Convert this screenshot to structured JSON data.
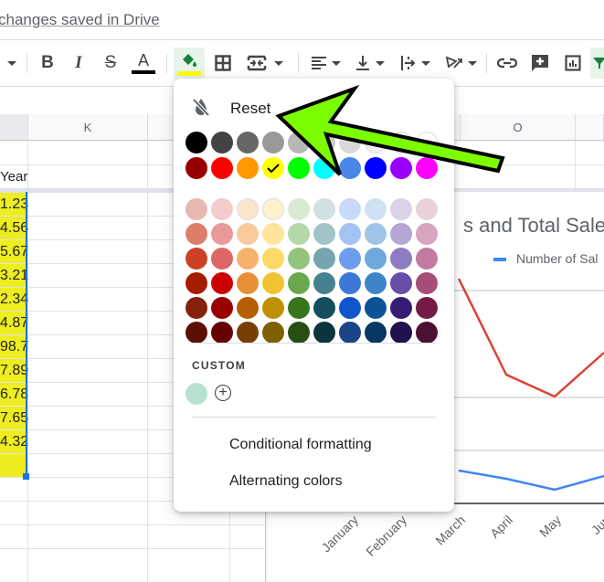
{
  "header": {
    "saved_status": "changes saved in Drive"
  },
  "toolbar": {
    "items": [
      "font-size-dropdown",
      "bold",
      "italic",
      "strikethrough",
      "text-color",
      "fill-color",
      "borders",
      "merge-cells",
      "horizontal-align",
      "vertical-align",
      "text-wrapping",
      "text-rotation",
      "insert-link",
      "insert-comment",
      "insert-chart",
      "filter"
    ],
    "bold_label": "B",
    "italic_label": "I",
    "strike_label": "S",
    "textcolor_label": "A",
    "text_color_bar": "#000000",
    "fill_color_bar": "#ffff00",
    "accent": "#188038"
  },
  "grid": {
    "columns": [
      {
        "label": ""
      },
      {
        "label": "K"
      },
      {
        "label": ""
      },
      {
        "label": ""
      },
      {
        "label": "O"
      },
      {
        "label": ""
      }
    ],
    "header_fragment": "Year",
    "values": [
      "1.23",
      "4.56",
      "5.67",
      "3.21",
      "2.34",
      "4.87",
      "98.7",
      "7.89",
      "6.78",
      "7.65",
      "4.32",
      ""
    ],
    "highlight_color": "#eded1f"
  },
  "fill_menu": {
    "reset_label": "Reset",
    "custom_label": "CUSTOM",
    "custom_colors": [
      "#b7e1cd"
    ],
    "add_custom_label": "+",
    "conditional_formatting_label": "Conditional formatting",
    "alternating_colors_label": "Alternating colors",
    "selected_color": "#ffff00",
    "palette": [
      [
        "#000000",
        "#434343",
        "#666666",
        "#999999",
        "#b7b7b7",
        "#cccccc",
        "#d9d9d9",
        "#efefef",
        "#f3f3f3",
        "#ffffff"
      ],
      [
        "#980000",
        "#ff0000",
        "#ff9900",
        "#ffff00",
        "#00ff00",
        "#00ffff",
        "#4a86e8",
        "#0000ff",
        "#9900ff",
        "#ff00ff"
      ],
      [
        "#e6b8af",
        "#f4cccc",
        "#fce5cd",
        "#fff2cc",
        "#d9ead3",
        "#d0e0e3",
        "#c9daf8",
        "#cfe2f3",
        "#d9d2e9",
        "#ead1dc"
      ],
      [
        "#dd7e6b",
        "#ea9999",
        "#f9cb9c",
        "#ffe599",
        "#b6d7a8",
        "#a2c4c9",
        "#a4c2f4",
        "#9fc5e8",
        "#b4a7d6",
        "#d5a6bd"
      ],
      [
        "#cc4125",
        "#e06666",
        "#f6b26b",
        "#ffd966",
        "#93c47d",
        "#76a5af",
        "#6d9eeb",
        "#6fa8dc",
        "#8e7cc3",
        "#c27ba0"
      ],
      [
        "#a61c00",
        "#cc0000",
        "#e69138",
        "#f1c232",
        "#6aa84f",
        "#45818e",
        "#3c78d8",
        "#3d85c6",
        "#674ea7",
        "#a64d79"
      ],
      [
        "#85200c",
        "#990000",
        "#b45f06",
        "#bf9000",
        "#38761d",
        "#134f5c",
        "#1155cc",
        "#0b5394",
        "#351c75",
        "#741b47"
      ],
      [
        "#5b0f00",
        "#660000",
        "#783f04",
        "#7f6000",
        "#274e13",
        "#0c343d",
        "#1c4587",
        "#073763",
        "#20124d",
        "#4c1130"
      ]
    ]
  },
  "chart": {
    "title_fragment": "s and Total Sale",
    "legend_label": "Number of Sal",
    "legend_color": "#4285f4",
    "series_red_color": "#db4437",
    "x_labels": [
      "January",
      "February",
      "March",
      "April",
      "May",
      "Jun"
    ],
    "red_series_visible": [
      {
        "x": "March",
        "rel": 0.82
      },
      {
        "x": "April",
        "rel": 0.47
      },
      {
        "x": "May",
        "rel": 0.39
      },
      {
        "x": "Jun",
        "rel": 0.55
      }
    ],
    "blue_series_visible": [
      {
        "x": "March",
        "rel": 0.12
      },
      {
        "x": "April",
        "rel": 0.09
      },
      {
        "x": "May",
        "rel": 0.05
      },
      {
        "x": "Jun",
        "rel": 0.1
      }
    ]
  },
  "annotation": {
    "arrow_color": "#7cfc00"
  }
}
